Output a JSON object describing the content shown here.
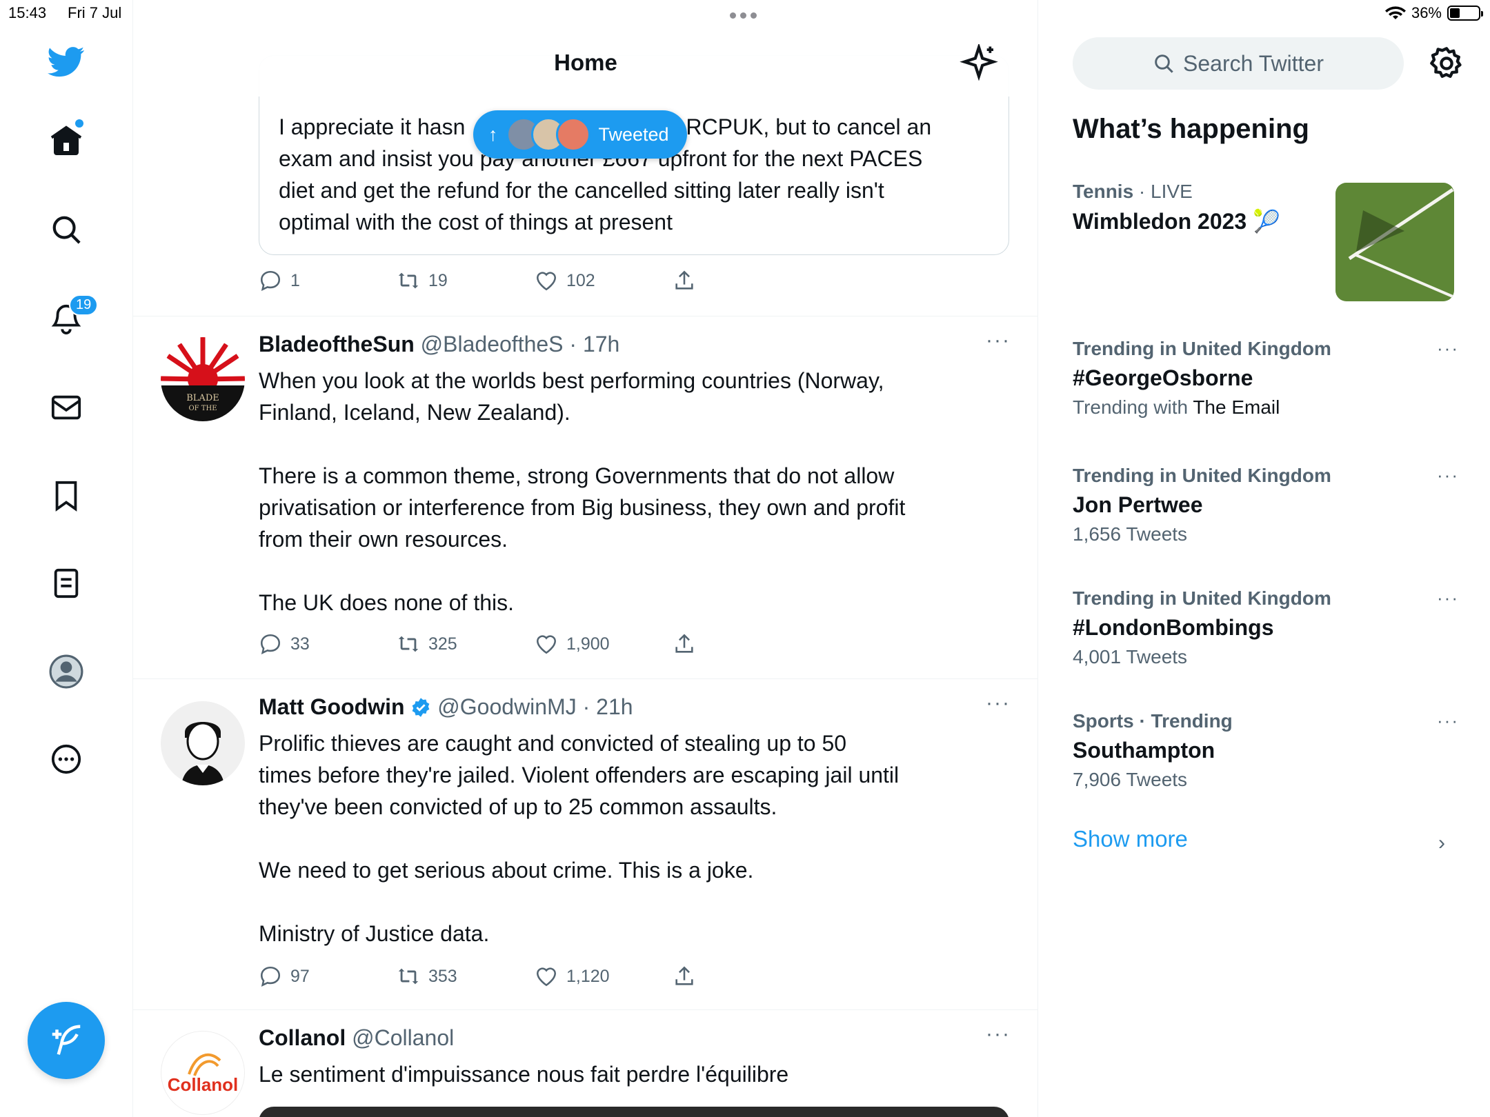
{
  "status_bar": {
    "time": "15:43",
    "date": "Fri 7 Jul",
    "battery_percent": "36%",
    "battery_level": 0.36
  },
  "nav": {
    "notifications_badge": "19",
    "items": [
      "home-icon",
      "explore-icon",
      "notifications-icon",
      "messages-icon",
      "bookmarks-icon",
      "lists-icon",
      "profile-icon",
      "more-icon"
    ]
  },
  "header": {
    "title": "Home"
  },
  "tweeted_pill": {
    "label": "Tweeted",
    "arrow": "↑"
  },
  "quoted_tweet": {
    "text": "I appreciate it hasn't been easy for the RCPUK, but to cancel an exam and insist you pay another £667 upfront for the next PACES diet and get the refund for the cancelled sitting later really isn't optimal with the cost of things at present",
    "line1a": "I appreciate it hasn",
    "line1b": "RCPUK, but to cancel an",
    "line2": "exam and insist you pay another £667 upfront for the next PACES",
    "line3": "diet and get the refund for the cancelled sitting later really isn't",
    "line4": "optimal with the cost of things at present",
    "replies": "1",
    "retweets": "19",
    "likes": "102"
  },
  "tweets": [
    {
      "name": "BladeoftheSun",
      "handle": "@BladeoftheS",
      "time": "· 17h",
      "avatar_text": "BLADE OF THE",
      "text": "When you look at the worlds best performing countries (Norway,\nFinland, Iceland, New Zealand).\n\nThere is a common theme, strong Governments that do not allow\nprivatisation or interference from Big business, they own and profit\nfrom their own resources.\n\nThe UK does none of this.",
      "replies": "33",
      "retweets": "325",
      "likes": "1,900"
    },
    {
      "name": "Matt Goodwin",
      "handle": "@GoodwinMJ",
      "time": "· 21h",
      "verified": true,
      "text": "Prolific thieves are caught and convicted of stealing up to 50\ntimes before they're jailed. Violent offenders are escaping jail until\nthey've been convicted of up to 25 common assaults.\n\nWe need to get serious about crime. This is a joke.\n\nMinistry of Justice data.",
      "replies": "97",
      "retweets": "353",
      "likes": "1,120"
    },
    {
      "name": "Collanol",
      "handle": "@Collanol",
      "time": "",
      "avatar_text": "Collanol",
      "text": "Le sentiment d'impuissance nous fait perdre l'équilibre"
    }
  ],
  "sidebar": {
    "search_placeholder": "Search Twitter",
    "whats_happening": "What’s happening",
    "trends": [
      {
        "category": "Tennis",
        "category_suffix": " · LIVE",
        "name": "Wimbledon 2023",
        "emoji": "🎾"
      },
      {
        "category": "Trending in United Kingdom",
        "name": "#GeorgeOsborne",
        "with_prefix": "Trending with ",
        "with_value": "The Email"
      },
      {
        "category": "Trending in United Kingdom",
        "name": "Jon Pertwee",
        "count": "1,656 Tweets"
      },
      {
        "category": "Trending in United Kingdom",
        "name": "#LondonBombings",
        "count": "4,001 Tweets"
      },
      {
        "category": "Sports · Trending",
        "name": "Southampton",
        "count": "7,906 Tweets"
      }
    ],
    "show_more": "Show more",
    "more_glyph": "···"
  },
  "colors": {
    "accent": "#1d9bf0",
    "secondary_text": "#536471",
    "border": "#eff3f4"
  }
}
